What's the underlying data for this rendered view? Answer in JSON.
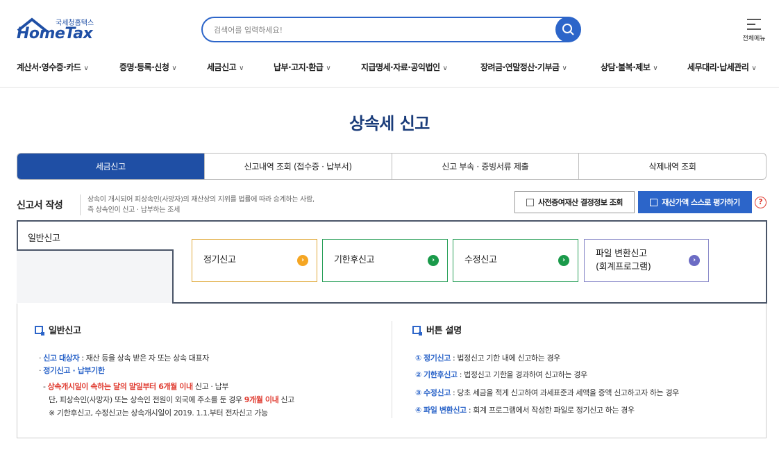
{
  "header": {
    "logo_sub": "국세청홈택스",
    "logo_main": "HomeTax",
    "search_placeholder": "검색어를 입력하세요!",
    "all_menu_label": "전체메뉴"
  },
  "gnb": [
    {
      "label": "계산서·영수증·카드"
    },
    {
      "label": "증명·등록·신청"
    },
    {
      "label": "세금신고"
    },
    {
      "label": "납부·고지·환급"
    },
    {
      "label": "지급명세·자료·공익법인"
    },
    {
      "label": "장려금·연말정산·기부금"
    },
    {
      "label": "상담·불복·제보"
    },
    {
      "label": "세무대리·납세관리"
    }
  ],
  "page_title": "상속세 신고",
  "tabs": [
    {
      "label": "세금신고",
      "active": true
    },
    {
      "label": "신고내역 조회 (접수증 · 납부서)"
    },
    {
      "label": "신고 부속 · 증빙서류 제출"
    },
    {
      "label": "삭제내역 조회"
    }
  ],
  "section": {
    "title": "신고서 작성",
    "desc_line1": "상속이 개시되어 피상속인(사망자)의 재산상의 지위를 법률에 따라 승계하는 사람,",
    "desc_line2": "즉 상속인이 신고 · 납부하는 조세",
    "btn_prior": "사전증여재산 결정정보 조회",
    "btn_self_eval": "재산가액 스스로 평가하기",
    "help": "?"
  },
  "panel": {
    "tab_label": "일반신고",
    "options": [
      {
        "label": "정기신고",
        "color": "#f5a623"
      },
      {
        "label": "기한후신고",
        "color": "#1a9a4a"
      },
      {
        "label": "수정신고",
        "color": "#1a9a4a"
      },
      {
        "label1": "파일 변환신고",
        "label2": "(회계프로그램)",
        "color": "#6b6bc4"
      }
    ]
  },
  "info_left": {
    "heading": "일반신고",
    "l1_key": "신고 대상자",
    "l1_val": " : 재산 등을 상속 받은 자 또는 상속 대표자",
    "l2_key": "정기신고 · 납부기한",
    "l3_red1": "상속개시일이 속하는 달의 말일부터 6개월 이내",
    "l3_rest": " 신고 · 납부",
    "l4_pre": "단, 피상속인(사망자) 또는 상속인 전원이 외국에 주소를 둔 경우 ",
    "l4_red": "9개월 이내",
    "l4_post": " 신고",
    "l5": "※ 기한후신고, 수정신고는 상속개시일이 2019. 1.1.부터 전자신고 가능"
  },
  "info_right": {
    "heading": "버튼 설명",
    "items": [
      {
        "num": "①",
        "key": "정기신고",
        "val": " : 법정신고 기한 내에 신고하는 경우"
      },
      {
        "num": "②",
        "key": "기한후신고",
        "val": " : 법정신고 기한을 경과하여 신고하는 경우"
      },
      {
        "num": "③",
        "key": "수정신고",
        "val": " : 당초 세금을 적게 신고하여 과세표준과 세액을 증액 신고하고자 하는 경우"
      },
      {
        "num": "④",
        "key": "파일 변환신고",
        "val": " : 회계 프로그램에서 작성한 파일로 정기신고 하는 경우"
      }
    ]
  },
  "colors": {
    "brand": "#1f4fa5",
    "accent": "#2c65c9",
    "red": "#e03c31"
  }
}
